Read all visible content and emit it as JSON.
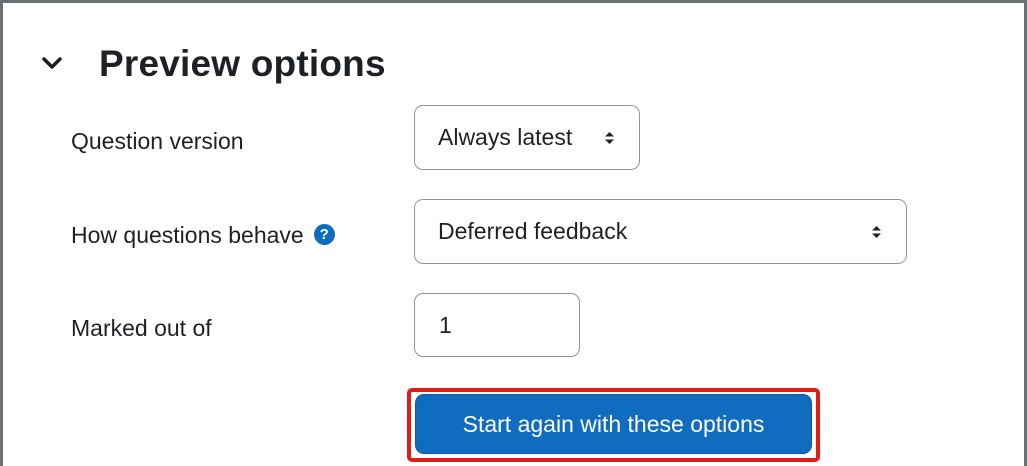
{
  "section": {
    "title": "Preview options"
  },
  "fields": {
    "question_version": {
      "label": "Question version",
      "value": "Always latest"
    },
    "how_questions_behave": {
      "label": "How questions behave",
      "value": "Deferred feedback"
    },
    "marked_out_of": {
      "label": "Marked out of",
      "value": "1"
    }
  },
  "actions": {
    "start_again_label": "Start again with these options"
  },
  "colors": {
    "primary": "#0f6cbf",
    "highlight": "#e01b1b",
    "text": "#1d2125"
  }
}
